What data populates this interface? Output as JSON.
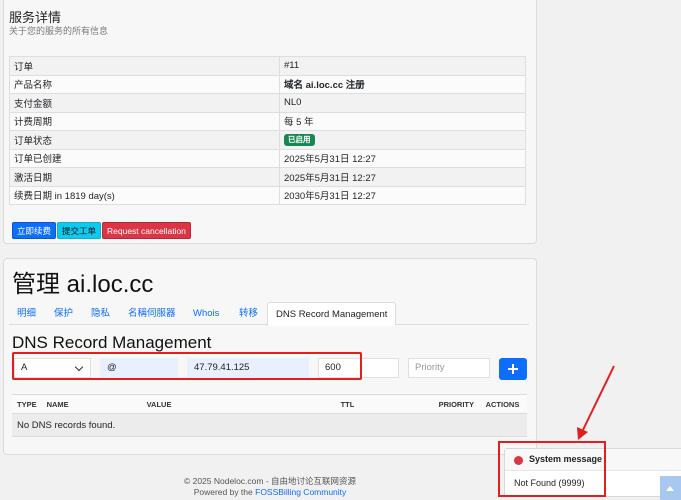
{
  "service": {
    "title": "服务详情",
    "subtitle": "关于您的服务的所有信息",
    "rows": [
      {
        "label": "订单",
        "value": "#11"
      },
      {
        "label": "产品名称",
        "value": "域名 ai.loc.cc 注册"
      },
      {
        "label": "支付金额",
        "value": "NL0"
      },
      {
        "label": "计费周期",
        "value": "每 5 年"
      },
      {
        "label": "订单状态",
        "value": "已启用"
      },
      {
        "label": "订单已创建",
        "value": "2025年5月31日 12:27"
      },
      {
        "label": "激活日期",
        "value": "2025年5月31日 12:27"
      },
      {
        "label": "续费日期 in 1819 day(s)",
        "value": "2030年5月31日 12:27"
      }
    ],
    "buttons": {
      "renew": "立即续费",
      "ticket": "提交工单",
      "cancel": "Request cancellation"
    }
  },
  "manage": {
    "title": "管理 ai.loc.cc",
    "tabs": [
      "明细",
      "保护",
      "隐私",
      "名稱伺服器",
      "Whois",
      "转移",
      "DNS Record Management"
    ],
    "active_tab": "DNS Record Management"
  },
  "dns": {
    "title": "DNS Record Management",
    "type_value": "A",
    "host_value": "@",
    "value_value": "47.79.41.125",
    "ttl_value": "600",
    "priority_placeholder": "Priority",
    "columns": [
      "TYPE",
      "NAME",
      "VALUE",
      "TTL",
      "PRIORITY",
      "ACTIONS"
    ],
    "empty_text": "No DNS records found."
  },
  "footer": {
    "line1": "© 2025 Nodeloc.com - 自由地讨论互联网资源",
    "powered_prefix": "Powered by the ",
    "powered_link": "FOSSBilling Community"
  },
  "toast": {
    "title": "System message",
    "body": "Not Found (9999)"
  },
  "colors": {
    "primary": "#0d6efd",
    "success": "#198754",
    "danger": "#dc3545",
    "info": "#0dcaf0",
    "annotation": "#e02020"
  }
}
